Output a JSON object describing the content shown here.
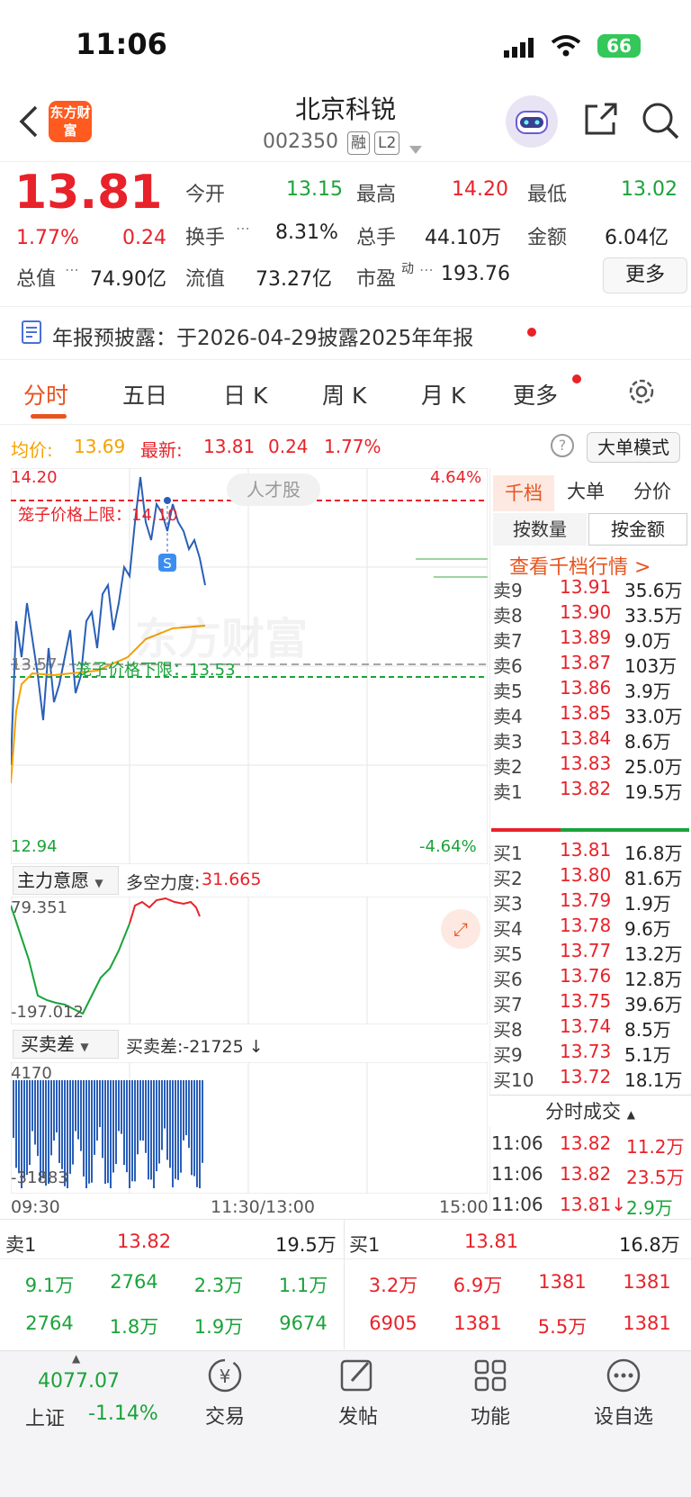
{
  "status": {
    "time": "11:06",
    "battery": "66"
  },
  "header": {
    "title": "北京科锐",
    "code": "002350",
    "tags": [
      "融",
      "L2"
    ],
    "logo": "东方财富"
  },
  "quote": {
    "price": "13.81",
    "pct": "1.77%",
    "chg": "0.24",
    "open_label": "今开",
    "open": "13.15",
    "high_label": "最高",
    "high": "14.20",
    "low_label": "最低",
    "low": "13.02",
    "turnover_label": "换手",
    "turnover": "8.31%",
    "vol_label": "总手",
    "vol": "44.10万",
    "amt_label": "金额",
    "amt": "6.04亿",
    "mcap_label": "总值",
    "mcap": "74.90亿",
    "float_label": "流值",
    "float": "73.27亿",
    "pe_label": "市盈",
    "pe_sup": "动",
    "pe": "193.76",
    "more": "更多"
  },
  "notice": "年报预披露：于2026-04-29披露2025年年报",
  "tabs": [
    "分时",
    "五日",
    "日 K",
    "周 K",
    "月 K",
    "更多"
  ],
  "chart": {
    "avg_label": "均价:",
    "avg": "13.69",
    "latest_label": "最新:",
    "latest": "13.81",
    "chg": "0.24",
    "pct": "1.77%",
    "big_mode": "大单模式",
    "y_top": "14.20",
    "y_bottom": "12.94",
    "pct_top": "4.64%",
    "pct_bottom": "-4.64%",
    "y_mid": "13.57",
    "upper_limit": "笼子价格上限：14.10",
    "lower_limit": "笼子价格下限：13.53",
    "watermark": "东方财富",
    "tag": "人才股",
    "ind1_name": "主力意愿",
    "ind1_text": "多空力度:",
    "ind1_val": "31.665",
    "ind1_top": "79.351",
    "ind1_bottom": "-197.012",
    "ind2_name": "买卖差",
    "ind2_text": "买卖差:-21725 ↓",
    "ind2_top": "4170",
    "ind2_bottom": "-31883",
    "x_labels": [
      "09:30",
      "11:30/13:00",
      "15:00"
    ]
  },
  "book": {
    "tabs": [
      "千档",
      "大单",
      "分价"
    ],
    "sub": [
      "按数量",
      "按金额"
    ],
    "link": "查看千档行情 >",
    "asks": [
      [
        "卖9",
        "13.91",
        "35.6万"
      ],
      [
        "卖8",
        "13.90",
        "33.5万"
      ],
      [
        "卖7",
        "13.89",
        "9.0万"
      ],
      [
        "卖6",
        "13.87",
        "103万"
      ],
      [
        "卖5",
        "13.86",
        "3.9万"
      ],
      [
        "卖4",
        "13.85",
        "33.0万"
      ],
      [
        "卖3",
        "13.84",
        "8.6万"
      ],
      [
        "卖2",
        "13.83",
        "25.0万"
      ],
      [
        "卖1",
        "13.82",
        "19.5万"
      ]
    ],
    "bids": [
      [
        "买1",
        "13.81",
        "16.8万"
      ],
      [
        "买2",
        "13.80",
        "81.6万"
      ],
      [
        "买3",
        "13.79",
        "1.9万"
      ],
      [
        "买4",
        "13.78",
        "9.6万"
      ],
      [
        "买5",
        "13.77",
        "13.2万"
      ],
      [
        "买6",
        "13.76",
        "12.8万"
      ],
      [
        "买7",
        "13.75",
        "39.6万"
      ],
      [
        "买8",
        "13.74",
        "8.5万"
      ],
      [
        "买9",
        "13.73",
        "5.1万"
      ],
      [
        "买10",
        "13.72",
        "18.1万"
      ]
    ],
    "trades_title": "分时成交",
    "trades": [
      [
        "11:06",
        "13.82",
        "11.2万"
      ],
      [
        "11:06",
        "13.82",
        "23.5万"
      ],
      [
        "11:06",
        "13.81↓",
        "2.9万"
      ]
    ]
  },
  "queue": {
    "sell_label": "卖1",
    "sell_price": "13.82",
    "sell_total": "19.5万",
    "buy_label": "买1",
    "buy_price": "13.81",
    "buy_total": "16.8万",
    "sell_rows": [
      [
        "9.1万",
        "2764",
        "2.3万",
        "1.1万"
      ],
      [
        "2764",
        "1.8万",
        "1.9万",
        "9674"
      ]
    ],
    "buy_rows": [
      [
        "3.2万",
        "6.9万",
        "1381",
        "1381"
      ],
      [
        "6905",
        "1381",
        "5.5万",
        "1381"
      ]
    ]
  },
  "bottom": {
    "index_value": "4077.07",
    "index_name": "上证",
    "index_pct": "-1.14%",
    "items": [
      "交易",
      "发帖",
      "功能",
      "设自选"
    ]
  }
}
